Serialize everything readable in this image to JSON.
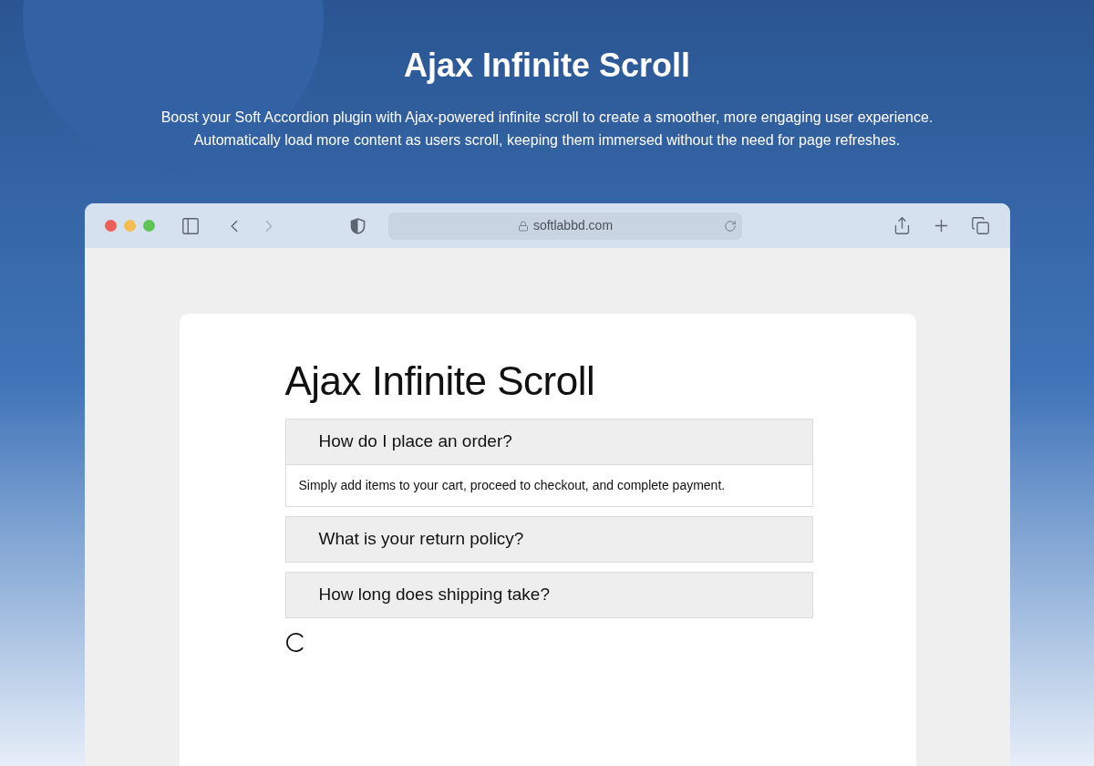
{
  "hero": {
    "title": "Ajax Infinite Scroll",
    "description": [
      "Boost your Soft Accordion plugin with Ajax-powered infinite scroll to create a smoother, more engaging user experience.",
      "Automatically load more content as users scroll, keeping them immersed without the need for page refreshes."
    ]
  },
  "browser": {
    "address": "softlabbd.com"
  },
  "page": {
    "title": "Ajax Infinite Scroll",
    "accordion": [
      {
        "question": "How do I place an order?",
        "answer": "Simply add items to your cart, proceed to checkout, and complete payment."
      },
      {
        "question": "What is your return policy?"
      },
      {
        "question": "How long does shipping take?"
      }
    ],
    "loading": true
  }
}
